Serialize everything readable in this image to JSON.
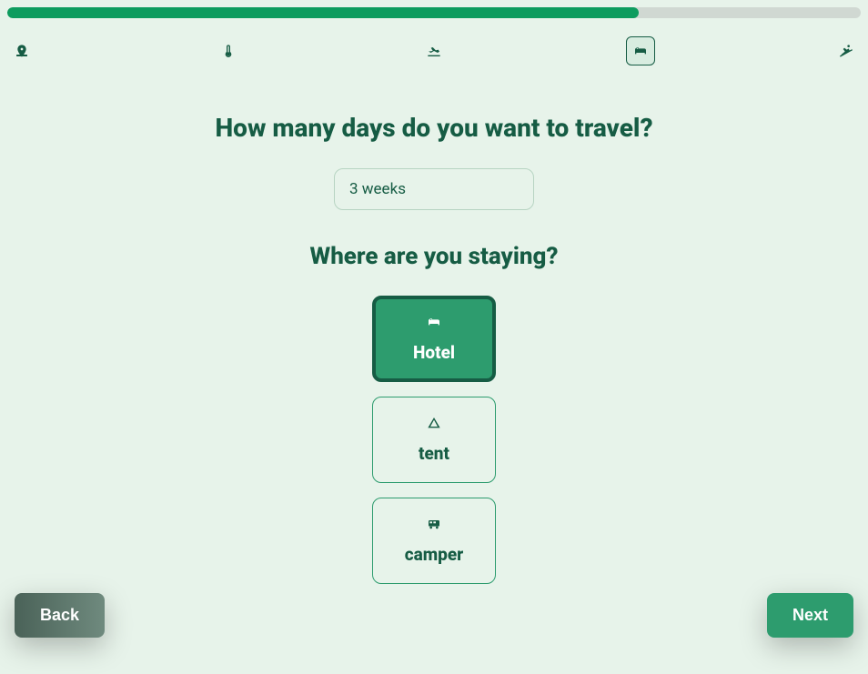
{
  "progress": {
    "percent": 74
  },
  "steps": {
    "current_index": 3,
    "icons": [
      "map-pin-icon",
      "thermometer-icon",
      "plane-departure-icon",
      "bed-icon",
      "snowboard-icon"
    ]
  },
  "question1": {
    "title": "How many days do you want to travel?",
    "input_value": "3 weeks"
  },
  "question2": {
    "title": "Where are you staying?",
    "selected": "Hotel",
    "options": [
      {
        "id": "hotel",
        "label": "Hotel",
        "icon": "bed-icon"
      },
      {
        "id": "tent",
        "label": "tent",
        "icon": "tent-icon"
      },
      {
        "id": "camper",
        "label": "camper",
        "icon": "bus-icon"
      }
    ]
  },
  "footer": {
    "back": "Back",
    "next": "Next"
  }
}
